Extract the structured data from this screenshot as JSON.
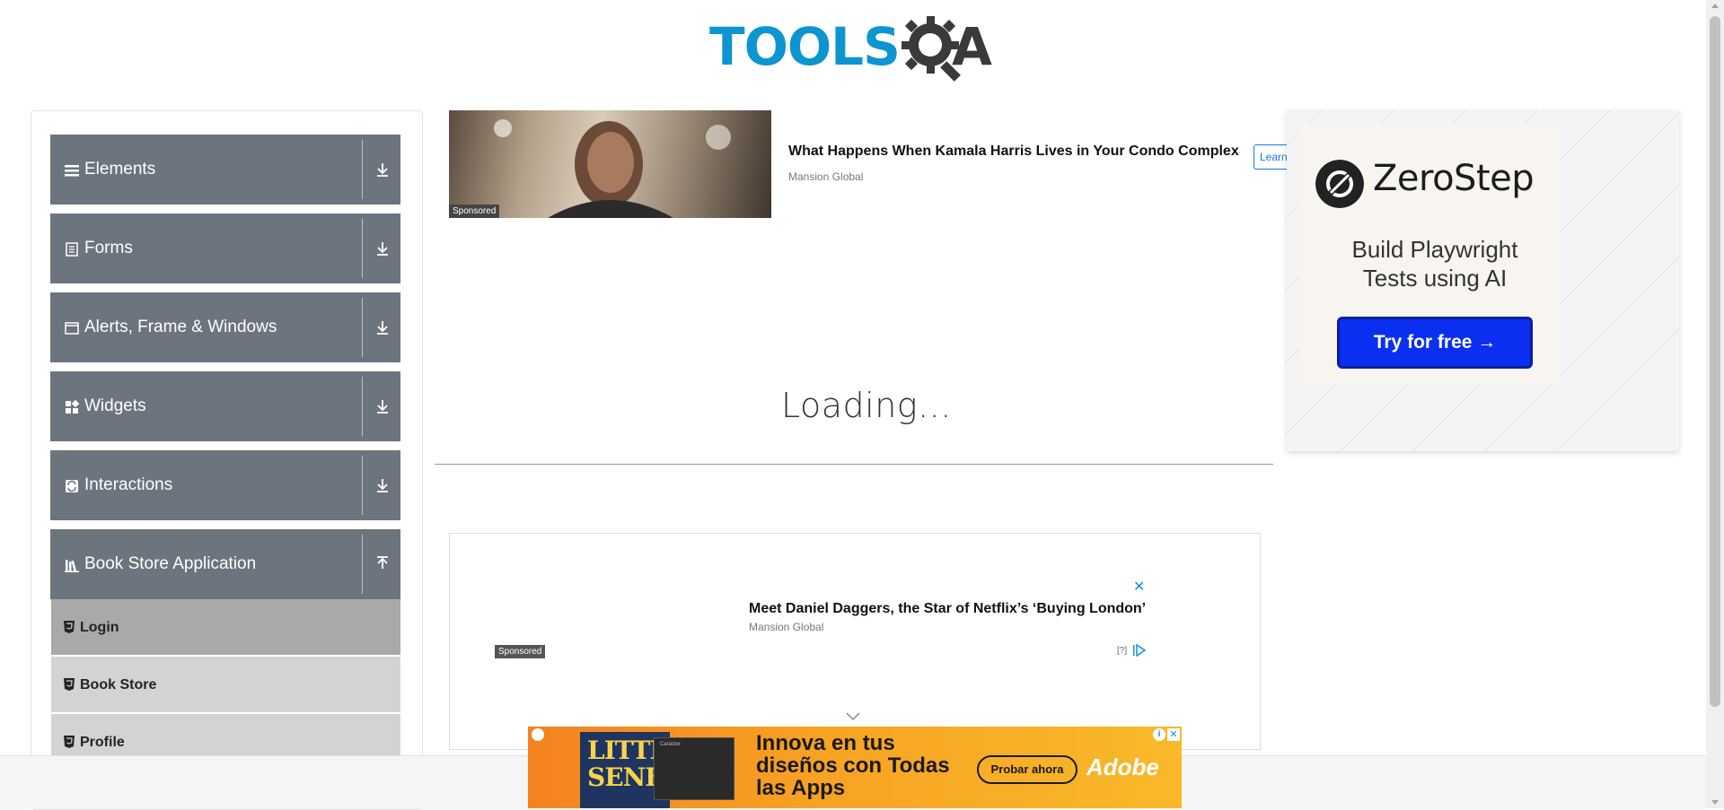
{
  "header": {
    "logo_text_blue": "TOOLS",
    "logo_text_dark": "A",
    "logo_icon": "gear-magnifier-icon"
  },
  "sidebar": {
    "groups": [
      {
        "label": "Elements",
        "icon": "hamburger-icon",
        "expanded": false
      },
      {
        "label": "Forms",
        "icon": "document-icon",
        "expanded": false
      },
      {
        "label": "Alerts, Frame & Windows",
        "icon": "window-icon",
        "expanded": false
      },
      {
        "label": "Widgets",
        "icon": "widgets-grid-icon",
        "expanded": false
      },
      {
        "label": "Interactions",
        "icon": "refresh-square-icon",
        "expanded": false
      },
      {
        "label": "Book Store Application",
        "icon": "books-icon",
        "expanded": true
      }
    ],
    "bookstore_items": [
      {
        "label": "Login",
        "icon": "html5-shield-icon",
        "active": true
      },
      {
        "label": "Book Store",
        "icon": "html5-shield-icon",
        "active": false
      },
      {
        "label": "Profile",
        "icon": "html5-shield-icon",
        "active": false
      }
    ]
  },
  "ads": {
    "top": {
      "sponsored": "Sponsored",
      "title": "What Happens When Kamala Harris Lives in Your Condo Complex",
      "source": "Mansion Global",
      "cta": "Learn"
    },
    "middle": {
      "close": "✕",
      "title": "Meet Daniel Daggers, the Star of Netflix’s ‘Buying London’",
      "source": "Mansion Global",
      "sponsored": "Sponsored",
      "help": "[?]"
    },
    "right": {
      "brand": "ZeroStep",
      "tagline_line1": "Build Playwright",
      "tagline_line2": "Tests using AI",
      "cta": "Try for free →"
    },
    "bottom": {
      "book_title": "LITTLE SENEGAL",
      "panel_title": "Carácter",
      "headline": "Innova en tus diseños con Todas las Apps",
      "cta": "Probar ahora",
      "brand": "Adobe",
      "info": "i",
      "close": "✕"
    }
  },
  "main": {
    "loading_text": "Loading..."
  },
  "colors": {
    "nav_bg": "#6c757d",
    "nav_item_bg": "#d3d3d3",
    "nav_item_active_bg": "#a9a9a9",
    "logo_blue": "#0d95d0",
    "cta_blue": "#0a2ff0"
  }
}
